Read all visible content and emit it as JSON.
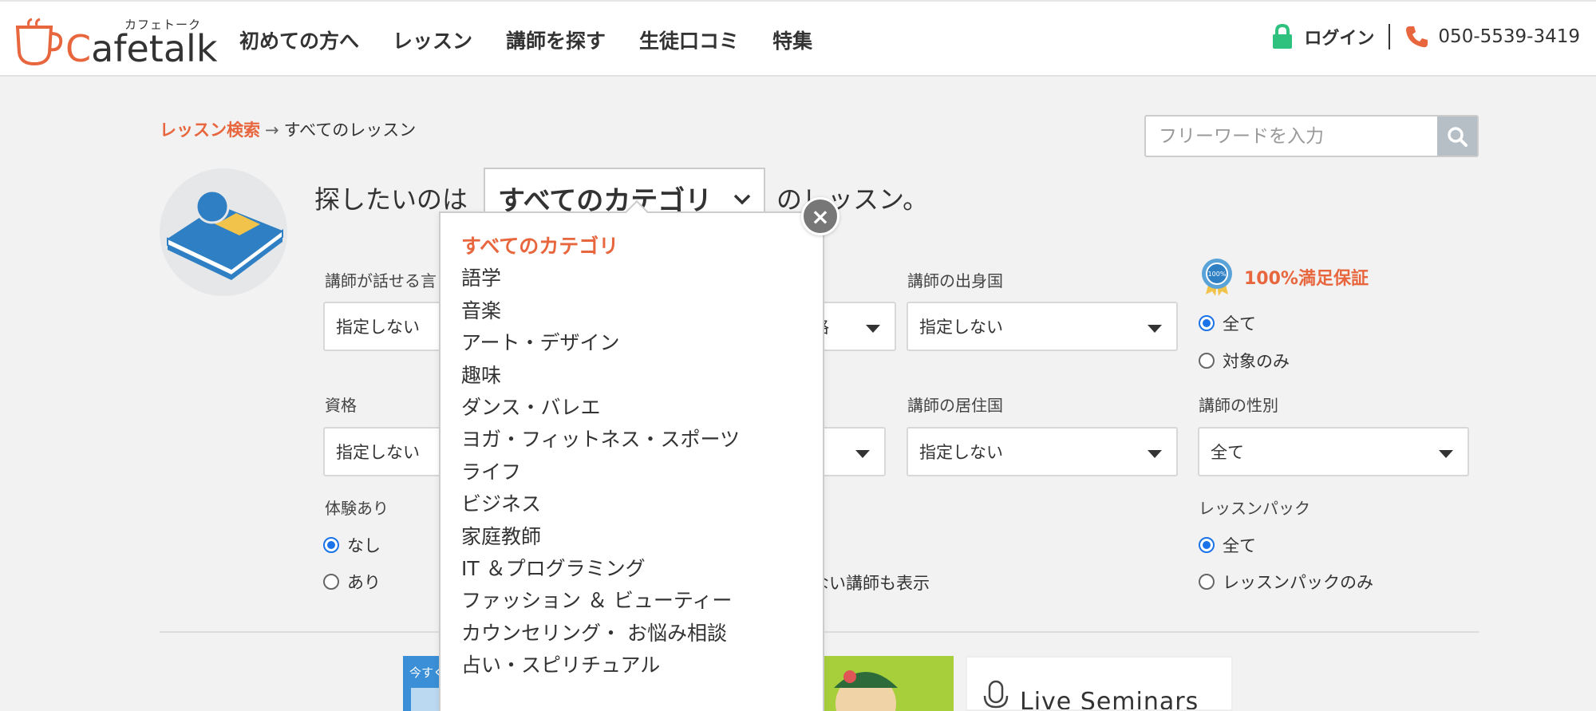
{
  "header": {
    "logo_kana": "カフェトーク",
    "logo_text_c": "C",
    "logo_text_rest": "afetalk",
    "nav": [
      "初めての方へ",
      "レッスン",
      "講師を探す",
      "生徒口コミ",
      "特集"
    ],
    "login_label": "ログイン",
    "phone": "050-5539-3419"
  },
  "breadcrumb": {
    "link": "レッスン検索",
    "arrow": "→",
    "current": "すべてのレッスン"
  },
  "search": {
    "placeholder": "フリーワードを入力"
  },
  "headline": {
    "prefix": "探したいのは",
    "category_value": "すべてのカテゴリ",
    "suffix": "のレッスン。"
  },
  "filters": {
    "speaks_label": "講師が話せる言",
    "speaks_value": "指定しない",
    "price_value_tail": "格",
    "origin_label": "講師の出身国",
    "origin_value": "指定しない",
    "guarantee_label": "100%満足保証",
    "guarantee_options": [
      "全て",
      "対象のみ"
    ],
    "qualification_label": "資格",
    "qualification_value": "指定しない",
    "residence_label": "講師の居住国",
    "residence_value": "指定しない",
    "gender_label": "講師の性別",
    "gender_value": "全て",
    "trial_label": "体験あり",
    "trial_options": [
      "なし",
      "あり"
    ],
    "hidden_tutors_tail": "ない講師も表示",
    "pack_label": "レッスンパック",
    "pack_options": [
      "全て",
      "レッスンパックのみ"
    ]
  },
  "dropdown": {
    "items": [
      "すべてのカテゴリ",
      "語学",
      "音楽",
      "アート・デザイン",
      "趣味",
      "ダンス・バレエ",
      "ヨガ・フィットネス・スポーツ",
      "ライフ",
      "ビジネス",
      "家庭教師",
      "IT ＆プログラミング",
      "ファッション ＆ ビューティー",
      "カウンセリング・ お悩み相談",
      "占い・スピリチュアル"
    ],
    "close_label": "×"
  },
  "banners": {
    "b1_text": "今すぐ",
    "b3_text": "Live Seminars"
  },
  "colors": {
    "brand": "#e8663d",
    "radio_on": "#1a73e8"
  }
}
